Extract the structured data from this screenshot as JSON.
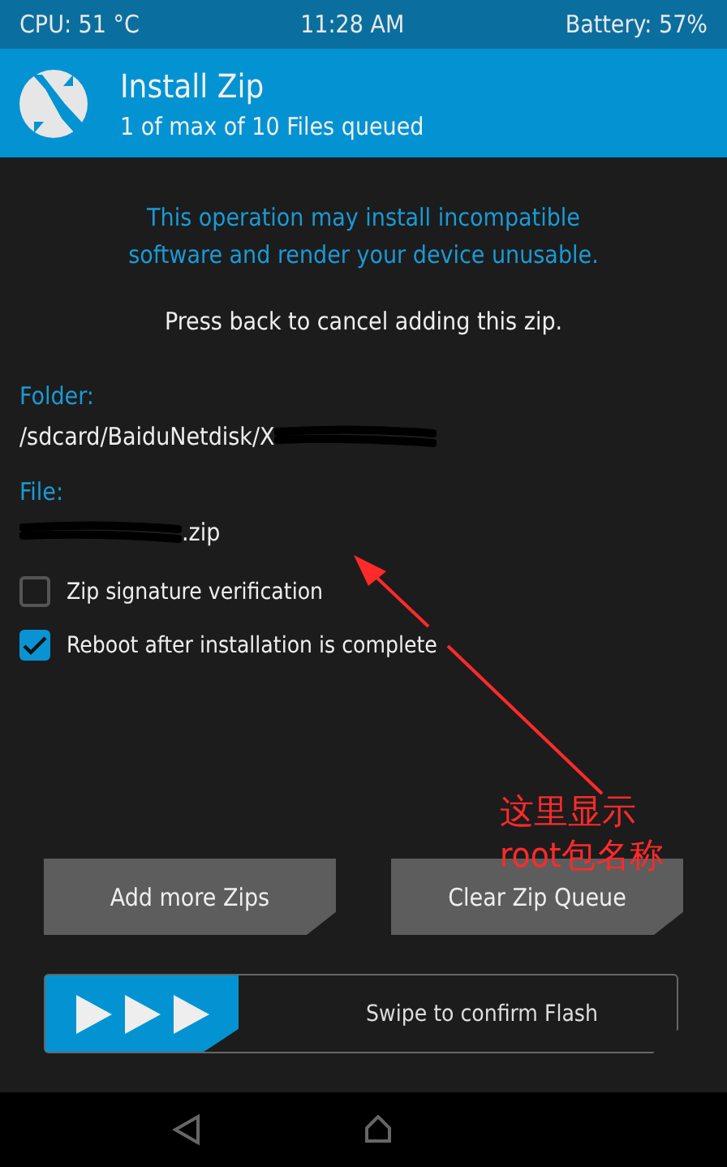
{
  "status_bar": {
    "cpu": "CPU: 51 °C",
    "time": "11:28 AM",
    "battery": "Battery: 57%"
  },
  "header": {
    "title": "Install Zip",
    "subtitle": "1 of max of 10 Files queued"
  },
  "warning": [
    "This operation may install incompatible",
    "software and render your device unusable."
  ],
  "hint": "Press back to cancel adding this zip.",
  "fields": [
    {
      "label": "Folder:",
      "value": "/sdcard/BaiduNetdisk/X",
      "redacted_before": false,
      "redacted_after": true
    },
    {
      "label": "File:",
      "value": ".zip",
      "redacted_before": true,
      "redacted_after": false
    }
  ],
  "options": [
    {
      "label": "Zip signature verification",
      "checked": false
    },
    {
      "label": "Reboot after installation is complete",
      "checked": true
    }
  ],
  "buttons": [
    "Add more Zips",
    "Clear Zip Queue"
  ],
  "swipe": {
    "label": "Swipe to confirm Flash",
    "level": 0
  },
  "annotation": {
    "lines": [
      "这里显示",
      "root包名称"
    ]
  }
}
